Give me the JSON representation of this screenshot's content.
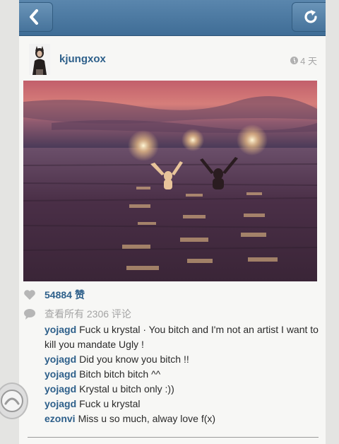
{
  "post": {
    "username": "kjungxox",
    "time": "4 天"
  },
  "stats": {
    "likes_count": "54884",
    "likes_label": "赞",
    "view_all_text": "查看所有 2306 评论"
  },
  "comments": [
    {
      "user": "yojagd",
      "text": "Fuck u krystal · You bitch and I'm not an artist I want to kill you mandate Ugly !"
    },
    {
      "user": "yojagd",
      "text": "Did you know you bitch !!"
    },
    {
      "user": "yojagd",
      "text": "Bitch bitch bitch ^^"
    },
    {
      "user": "yojagd",
      "text": "Krystal u bitch only :))"
    },
    {
      "user": "yojagd",
      "text": "Fuck u krystal"
    },
    {
      "user": "ezonvi",
      "text": "Miss u so much, alway love f(x)"
    }
  ],
  "icons": {
    "back": "chevron-left-icon",
    "refresh": "refresh-icon",
    "time": "clock-icon",
    "like": "heart-icon",
    "comment": "comment-bubble-icon"
  },
  "colors": {
    "navbar": "#4a78a2",
    "username": "#2d5f8a",
    "muted": "#a4a4a4"
  }
}
